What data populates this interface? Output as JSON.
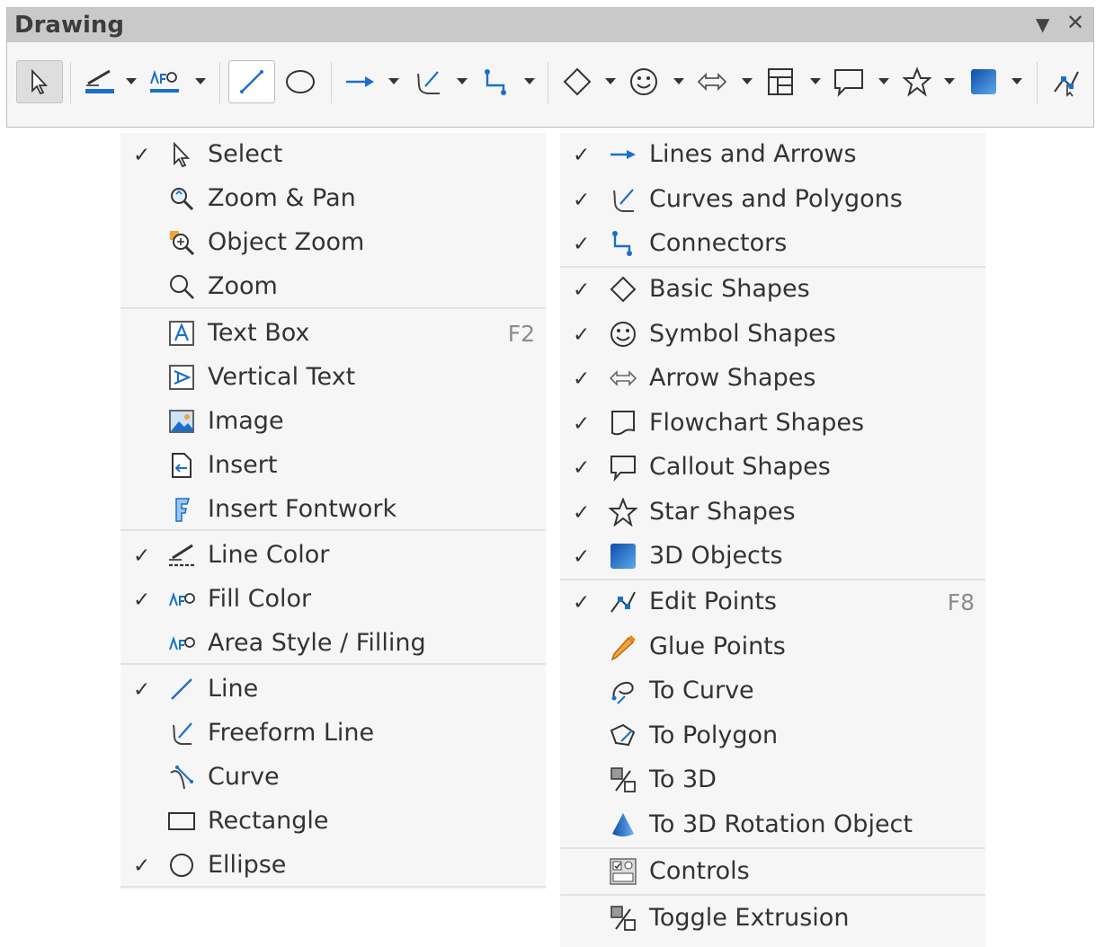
{
  "window": {
    "title": "Drawing"
  },
  "colors": {
    "accent": "#1a6fc9",
    "menu_bg": "#f6f6f6",
    "titlebar_bg": "#c9c9c9"
  },
  "toolbar": {
    "tools": [
      {
        "name": "select",
        "icon": "pointer-icon"
      },
      {
        "name": "line-color",
        "icon": "line-color-icon"
      },
      {
        "name": "fill-color",
        "icon": "fill-color-icon"
      },
      {
        "name": "line",
        "icon": "line-icon"
      },
      {
        "name": "ellipse",
        "icon": "ellipse-icon"
      },
      {
        "name": "lines-and-arrows",
        "icon": "arrow-line-icon"
      },
      {
        "name": "curves-and-polygons",
        "icon": "curve-icon"
      },
      {
        "name": "connectors",
        "icon": "connector-icon"
      },
      {
        "name": "basic-shapes",
        "icon": "diamond-icon"
      },
      {
        "name": "symbol-shapes",
        "icon": "smiley-icon"
      },
      {
        "name": "arrow-shapes",
        "icon": "double-arrow-icon"
      },
      {
        "name": "flowchart-shapes",
        "icon": "flowchart-icon"
      },
      {
        "name": "callout-shapes",
        "icon": "callout-icon"
      },
      {
        "name": "star-shapes",
        "icon": "star-icon"
      },
      {
        "name": "3d-objects",
        "icon": "cube-icon"
      },
      {
        "name": "edit-points",
        "icon": "edit-points-icon"
      }
    ]
  },
  "left_menu": [
    {
      "label": "Select",
      "checked": true,
      "icon": "pointer-icon",
      "shortcut": ""
    },
    {
      "label": "Zoom & Pan",
      "checked": false,
      "icon": "zoom-pan-icon",
      "shortcut": ""
    },
    {
      "label": "Object Zoom",
      "checked": false,
      "icon": "object-zoom-icon",
      "shortcut": ""
    },
    {
      "label": "Zoom",
      "checked": false,
      "icon": "zoom-icon",
      "shortcut": ""
    },
    {
      "label": "Text Box",
      "checked": false,
      "icon": "text-box-icon",
      "shortcut": "F2"
    },
    {
      "label": "Vertical Text",
      "checked": false,
      "icon": "vertical-text-icon",
      "shortcut": ""
    },
    {
      "label": "Image",
      "checked": false,
      "icon": "image-icon",
      "shortcut": ""
    },
    {
      "label": "Insert",
      "checked": false,
      "icon": "insert-icon",
      "shortcut": ""
    },
    {
      "label": "Insert Fontwork",
      "checked": false,
      "icon": "fontwork-icon",
      "shortcut": ""
    },
    {
      "label": "Line Color",
      "checked": true,
      "icon": "line-color-icon",
      "shortcut": ""
    },
    {
      "label": "Fill Color",
      "checked": true,
      "icon": "fill-color-icon",
      "shortcut": ""
    },
    {
      "label": "Area Style / Filling",
      "checked": false,
      "icon": "area-style-icon",
      "shortcut": ""
    },
    {
      "label": "Line",
      "checked": true,
      "icon": "line-icon",
      "shortcut": ""
    },
    {
      "label": "Freeform Line",
      "checked": false,
      "icon": "freeform-line-icon",
      "shortcut": ""
    },
    {
      "label": "Curve",
      "checked": false,
      "icon": "curve-icon",
      "shortcut": ""
    },
    {
      "label": "Rectangle",
      "checked": false,
      "icon": "rectangle-icon",
      "shortcut": ""
    },
    {
      "label": "Ellipse",
      "checked": true,
      "icon": "ellipse-icon",
      "shortcut": ""
    }
  ],
  "right_menu": [
    {
      "label": "Lines and Arrows",
      "checked": true,
      "icon": "arrow-line-icon",
      "shortcut": ""
    },
    {
      "label": "Curves and Polygons",
      "checked": true,
      "icon": "curve-polygon-icon",
      "shortcut": ""
    },
    {
      "label": "Connectors",
      "checked": true,
      "icon": "connector-icon",
      "shortcut": ""
    },
    {
      "label": "Basic Shapes",
      "checked": true,
      "icon": "diamond-icon",
      "shortcut": ""
    },
    {
      "label": "Symbol Shapes",
      "checked": true,
      "icon": "smiley-icon",
      "shortcut": ""
    },
    {
      "label": "Arrow Shapes",
      "checked": true,
      "icon": "double-arrow-icon",
      "shortcut": ""
    },
    {
      "label": "Flowchart Shapes",
      "checked": true,
      "icon": "flowchart-icon",
      "shortcut": ""
    },
    {
      "label": "Callout Shapes",
      "checked": true,
      "icon": "callout-icon",
      "shortcut": ""
    },
    {
      "label": "Star Shapes",
      "checked": true,
      "icon": "star-icon",
      "shortcut": ""
    },
    {
      "label": "3D Objects",
      "checked": true,
      "icon": "cube-icon",
      "shortcut": ""
    },
    {
      "label": "Edit Points",
      "checked": true,
      "icon": "edit-points-icon",
      "shortcut": "F8"
    },
    {
      "label": "Glue Points",
      "checked": false,
      "icon": "glue-points-icon",
      "shortcut": ""
    },
    {
      "label": "To Curve",
      "checked": false,
      "icon": "to-curve-icon",
      "shortcut": ""
    },
    {
      "label": "To Polygon",
      "checked": false,
      "icon": "to-polygon-icon",
      "shortcut": ""
    },
    {
      "label": "To 3D",
      "checked": false,
      "icon": "to-3d-icon",
      "shortcut": ""
    },
    {
      "label": "To 3D Rotation Object",
      "checked": false,
      "icon": "to-3d-rotation-icon",
      "shortcut": ""
    },
    {
      "label": "Controls",
      "checked": false,
      "icon": "controls-icon",
      "shortcut": ""
    },
    {
      "label": "Toggle Extrusion",
      "checked": false,
      "icon": "toggle-extrusion-icon",
      "shortcut": ""
    }
  ]
}
